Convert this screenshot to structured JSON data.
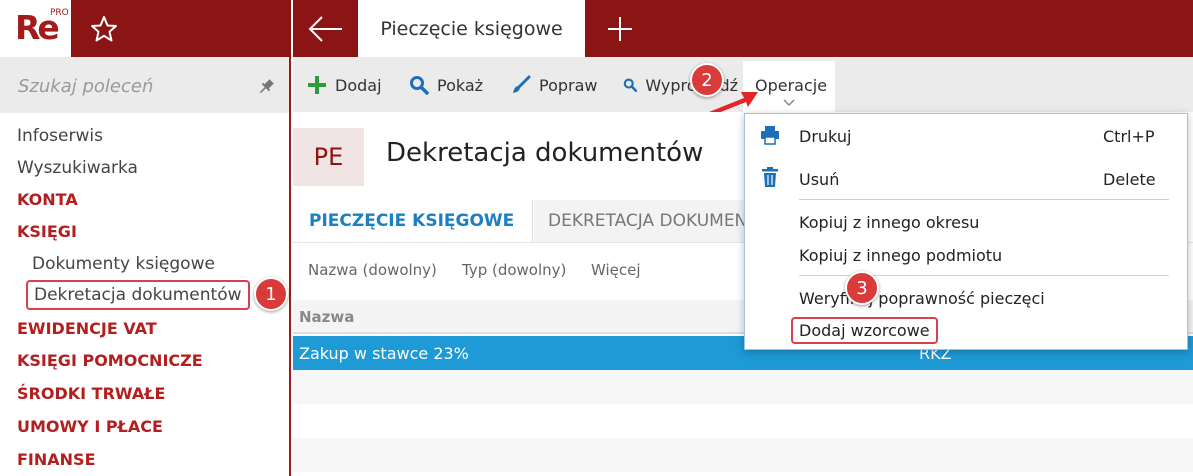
{
  "app": {
    "logo_text": "Re",
    "logo_badge": "PRO",
    "active_tab_title": "Pieczęcie księgowe"
  },
  "sidebar": {
    "search_placeholder": "Szukaj poleceń",
    "items": [
      {
        "label": "Infoserwis",
        "kind": "plain"
      },
      {
        "label": "Wyszukiwarka",
        "kind": "plain"
      },
      {
        "label": "KONTA",
        "kind": "category"
      },
      {
        "label": "KSIĘGI",
        "kind": "category"
      },
      {
        "label": "Dokumenty księgowe",
        "kind": "sub"
      },
      {
        "label": "Dekretacja dokumentów",
        "kind": "sub-selected"
      },
      {
        "label": "EWIDENCJE VAT",
        "kind": "category"
      },
      {
        "label": "KSIĘGI POMOCNICZE",
        "kind": "category"
      },
      {
        "label": "ŚRODKI TRWAŁE",
        "kind": "category"
      },
      {
        "label": "UMOWY I PŁACE",
        "kind": "category"
      },
      {
        "label": "FINANSE",
        "kind": "category"
      }
    ]
  },
  "toolbar": {
    "add_label": "Dodaj",
    "show_label": "Pokaż",
    "edit_label": "Popraw",
    "print_label": "Wyprowadź",
    "operations_label": "Operacje"
  },
  "document": {
    "badge": "PE",
    "title": "Dekretacja dokumentów",
    "tabs": [
      {
        "label": "PIECZĘCIE KSIĘGOWE",
        "active": true
      },
      {
        "label": "DEKRETACJA DOKUMENTÓW",
        "active": false
      }
    ],
    "filters": [
      {
        "label": "Nazwa (dowolny)"
      },
      {
        "label": "Typ (dowolny)"
      },
      {
        "label": "Więcej"
      }
    ]
  },
  "grid": {
    "columns": [
      "Nazwa"
    ],
    "rows": [
      {
        "name": "Zakup w stawce 23%",
        "type": "RKZ",
        "selected": true
      }
    ]
  },
  "dropdown": {
    "items": [
      {
        "label": "Drukuj",
        "shortcut": "Ctrl+P",
        "icon": "printer-icon"
      },
      {
        "label": "Usuń",
        "shortcut": "Delete",
        "icon": "trash-icon"
      },
      {
        "label": "Kopiuj z innego okresu"
      },
      {
        "label": "Kopiuj z innego podmiotu"
      },
      {
        "label": "Weryfikuj poprawność pieczęci"
      },
      {
        "label": "Dodaj wzorcowe",
        "highlighted": true
      }
    ]
  },
  "callouts": [
    "1",
    "2",
    "3"
  ],
  "colors": {
    "brand": "#8b1414",
    "category": "#b31e1e",
    "accent": "#1c7fc4",
    "selected_row": "#1e9ad6",
    "callout": "#d93a3a"
  }
}
